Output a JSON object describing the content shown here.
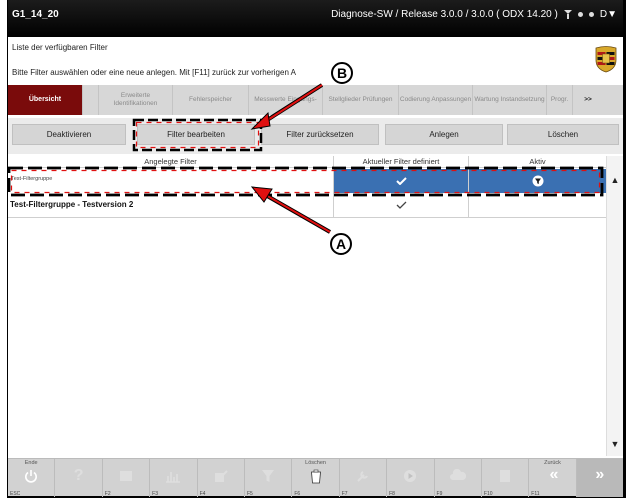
{
  "titlebar": {
    "left": "G1_14_20",
    "right": "Diagnose-SW / Release 3.0.0 / 3.0.0  ( ODX  14.20 )",
    "d_label": "D"
  },
  "header": {
    "title": "Liste der verfügbaren Filter",
    "instruction": "Bitte Filter auswählen oder eine neue anlegen. Mit [F11] zurück zur vorherigen A"
  },
  "nav": {
    "tabs": [
      {
        "label": "Übersicht",
        "active": true
      },
      {
        "label": "",
        "active": false
      },
      {
        "label": "Erweiterte Identifikationen",
        "active": false
      },
      {
        "label": "Fehlerspeicher",
        "active": false
      },
      {
        "label": "Messwerte Eingangs-",
        "active": false
      },
      {
        "label": "Stellglieder Prüfungen",
        "active": false
      },
      {
        "label": "Codierung Anpassungen",
        "active": false
      },
      {
        "label": "Wartung Instandsetzung",
        "active": false
      },
      {
        "label": "Progr.",
        "active": false
      }
    ],
    "more": ">>"
  },
  "buttons": {
    "deactivate": "Deaktivieren",
    "edit": "Filter bearbeiten",
    "reset": "Filter zurücksetzen",
    "create": "Anlegen",
    "delete": "Löschen"
  },
  "table": {
    "columns": [
      "Angelegte Filter",
      "Aktueller Filter definiert",
      "Aktiv"
    ],
    "rows": [
      {
        "name": "Test-Filtergruppe",
        "defined": true,
        "active": true,
        "selected": true
      },
      {
        "name": "Test-Filtergruppe - Testversion 2",
        "defined": true,
        "active": false,
        "selected": false
      }
    ]
  },
  "toolbar": {
    "items": [
      {
        "label": "Ende",
        "key": "ESC",
        "icon": "power-icon",
        "enabled": true
      },
      {
        "label": "",
        "key": "",
        "icon": "help-icon",
        "enabled": false
      },
      {
        "label": "",
        "key": "F2",
        "icon": "list-icon",
        "enabled": false
      },
      {
        "label": "",
        "key": "F3",
        "icon": "chart-icon",
        "enabled": false
      },
      {
        "label": "",
        "key": "F4",
        "icon": "edit-icon",
        "enabled": false
      },
      {
        "label": "",
        "key": "F5",
        "icon": "filter-icon",
        "enabled": false
      },
      {
        "label": "Löschen",
        "key": "F6",
        "icon": "clear-icon",
        "enabled": true
      },
      {
        "label": "",
        "key": "F7",
        "icon": "tool-icon",
        "enabled": false
      },
      {
        "label": "",
        "key": "F8",
        "icon": "play-icon",
        "enabled": false
      },
      {
        "label": "",
        "key": "F9",
        "icon": "cloud-icon",
        "enabled": false
      },
      {
        "label": "",
        "key": "F10",
        "icon": "document-icon",
        "enabled": false
      },
      {
        "label": "Zurück",
        "key": "F11",
        "icon": "back-icon",
        "enabled": true
      },
      {
        "label": "",
        "key": "",
        "icon": "forward-icon",
        "enabled": true
      }
    ]
  },
  "annotations": {
    "a": "A",
    "b": "B"
  },
  "colors": {
    "active_tab": "#7a0b0b",
    "selected_row": "#3a70b2",
    "annotation_red": "#e01010"
  }
}
